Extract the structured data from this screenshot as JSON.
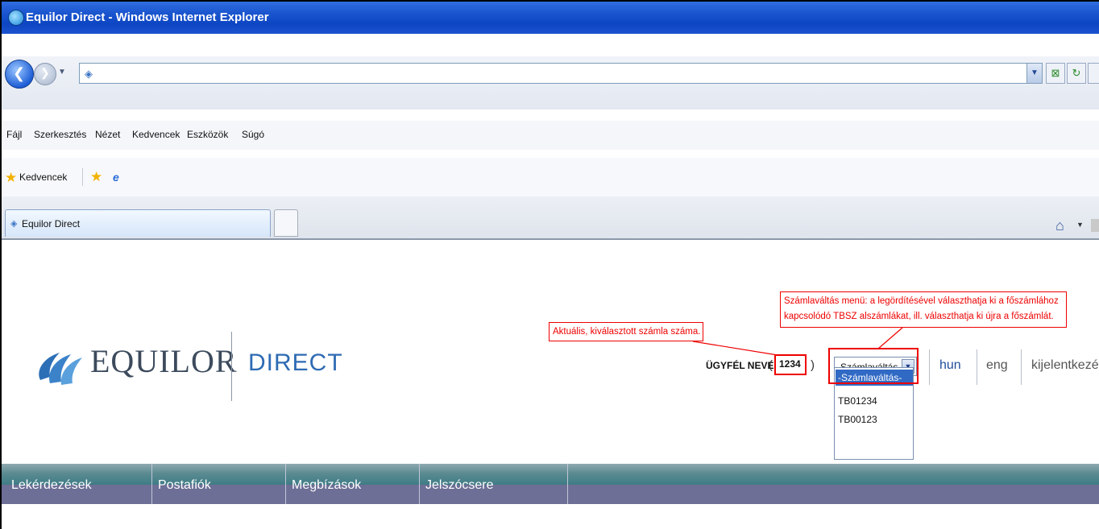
{
  "window": {
    "title": "Equilor Direct - Windows Internet Explorer"
  },
  "menu": [
    "Fájl",
    "Szerkesztés",
    "Nézet",
    "Kedvencek",
    "Eszközök",
    "Súgó"
  ],
  "favorites": {
    "label": "Kedvencek"
  },
  "tab": {
    "label": "Equilor Direct"
  },
  "logo": {
    "name": "EQUILOR",
    "direct": "DIRECT"
  },
  "client": {
    "label": "ÜGYFÉL NEVE",
    "open_paren": "(",
    "account": "1234",
    "close_paren": ")"
  },
  "account_select": {
    "value": "-Számlaváltás-",
    "options": [
      "-Számlaváltás-",
      "TB01234",
      "TB00123"
    ]
  },
  "links": {
    "hun": "hun",
    "eng": "eng",
    "logout": "kijelentkezés"
  },
  "annotations": {
    "current_account": "Aktuális, kiválasztott számla száma.",
    "switch_menu_line1": "Számlaváltás menü: a legördítésével választhatja ki a főszámlához",
    "switch_menu_line2": "kapcsolódó TBSZ alszámlákat, ill. választhatja ki újra a főszámlát."
  },
  "nav": [
    "Lekérdezések",
    "Postafiók",
    "Megbízások",
    "Jelszócsere"
  ],
  "colors": {
    "titlebar": "#1b56cf",
    "accent": "#2e6bb3",
    "annotation": "#e00000",
    "nav": "#6e6f96"
  }
}
